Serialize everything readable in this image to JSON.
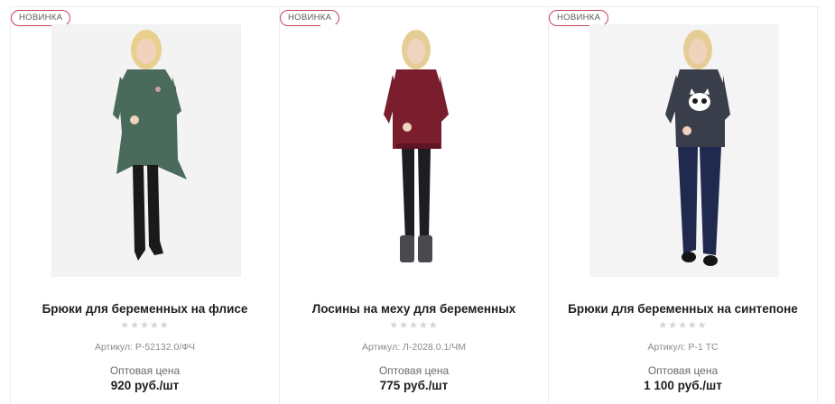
{
  "products": [
    {
      "badge": "НОВИНКА",
      "title": "Брюки для беременных на флисе",
      "stars": "★★★★★",
      "sku": "Артикул: Р-52132.0/ФЧ",
      "price_label": "Оптовая цена",
      "price": "920 руб./шт",
      "colors": {
        "top": "#4a6a5c",
        "bottom": "#1a1a1a"
      }
    },
    {
      "badge": "НОВИНКА",
      "title": "Лосины на меху для беременных",
      "stars": "★★★★★",
      "sku": "Артикул: Л-2028.0.1/ЧМ",
      "price_label": "Оптовая цена",
      "price": "775 руб./шт",
      "colors": {
        "top": "#7a1e2e",
        "bottom": "#1e1e22"
      }
    },
    {
      "badge": "НОВИНКА",
      "title": "Брюки для беременных на синтепоне",
      "stars": "★★★★★",
      "sku": "Артикул: Р-1 ТС",
      "price_label": "Оптовая цена",
      "price": "1 100 руб./шт",
      "colors": {
        "top": "#3a3e4a",
        "bottom": "#1f2a4e"
      }
    }
  ]
}
